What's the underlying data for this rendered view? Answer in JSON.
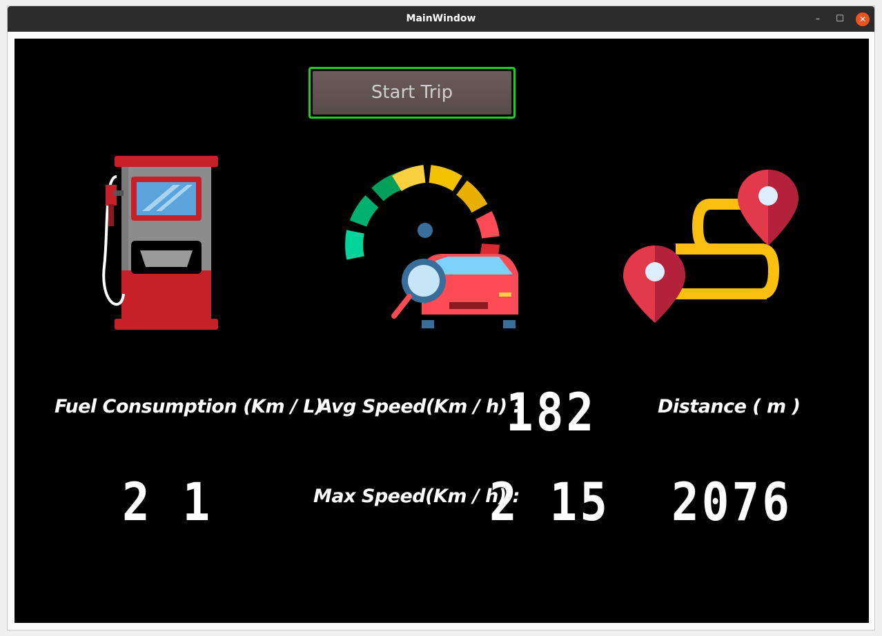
{
  "window": {
    "title": "MainWindow",
    "controls": {
      "minimize": "–",
      "maximize": "☐",
      "close": "✕"
    }
  },
  "toolbar": {
    "start_label": "Start Trip"
  },
  "metrics": {
    "fuel": {
      "label": "Fuel Consumption (Km / L)",
      "value": "2 1"
    },
    "avg_speed": {
      "label": "Avg Speed(Km / h) :",
      "value": "182"
    },
    "max_speed": {
      "label": "Max Speed(Km / h) :",
      "value": "2 15"
    },
    "distance": {
      "label": "Distance ( m )",
      "value": "2076"
    }
  },
  "icons": [
    "fuel-pump-icon",
    "speedometer-car-icon",
    "route-distance-icon"
  ],
  "colors": {
    "accent_border": "#1fd11f",
    "button_bg": "#5f5250",
    "close": "#e95420"
  }
}
